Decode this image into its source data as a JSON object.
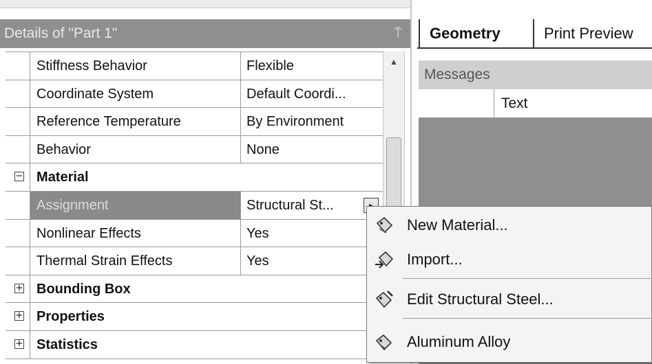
{
  "details": {
    "title": "Details of \"Part 1\"",
    "rows": [
      {
        "prop": "Stiffness Behavior",
        "value": "Flexible"
      },
      {
        "prop": "Coordinate System",
        "value": "Default Coordi..."
      },
      {
        "prop": "Reference Temperature",
        "value": "By Environment"
      },
      {
        "prop": "Behavior",
        "value": "None"
      },
      {
        "group": "Material",
        "toggle": "−"
      },
      {
        "prop": "Assignment",
        "value": "Structural St..."
      },
      {
        "prop": "Nonlinear Effects",
        "value": "Yes"
      },
      {
        "prop": "Thermal Strain Effects",
        "value": "Yes"
      },
      {
        "group": "Bounding Box",
        "toggle": "+"
      },
      {
        "group": "Properties",
        "toggle": "+"
      },
      {
        "group": "Statistics",
        "toggle": "+"
      }
    ],
    "dropdown_glyph": "▸"
  },
  "tabs": {
    "geometry": "Geometry",
    "print_preview": "Print Preview"
  },
  "messages": {
    "title": "Messages",
    "column_text": "Text"
  },
  "context_menu": {
    "items": [
      {
        "label": "New Material...",
        "icon": "new-material-icon"
      },
      {
        "label": "Import...",
        "icon": "import-icon"
      },
      {
        "label": "Edit Structural Steel...",
        "icon": "edit-material-icon"
      },
      {
        "label": "Aluminum Alloy",
        "icon": "material-icon"
      }
    ]
  },
  "colors": {
    "header_bg": "#8f8f8f",
    "selected_bg": "#8a8a8a",
    "messages_body": "#8f8f8f"
  }
}
